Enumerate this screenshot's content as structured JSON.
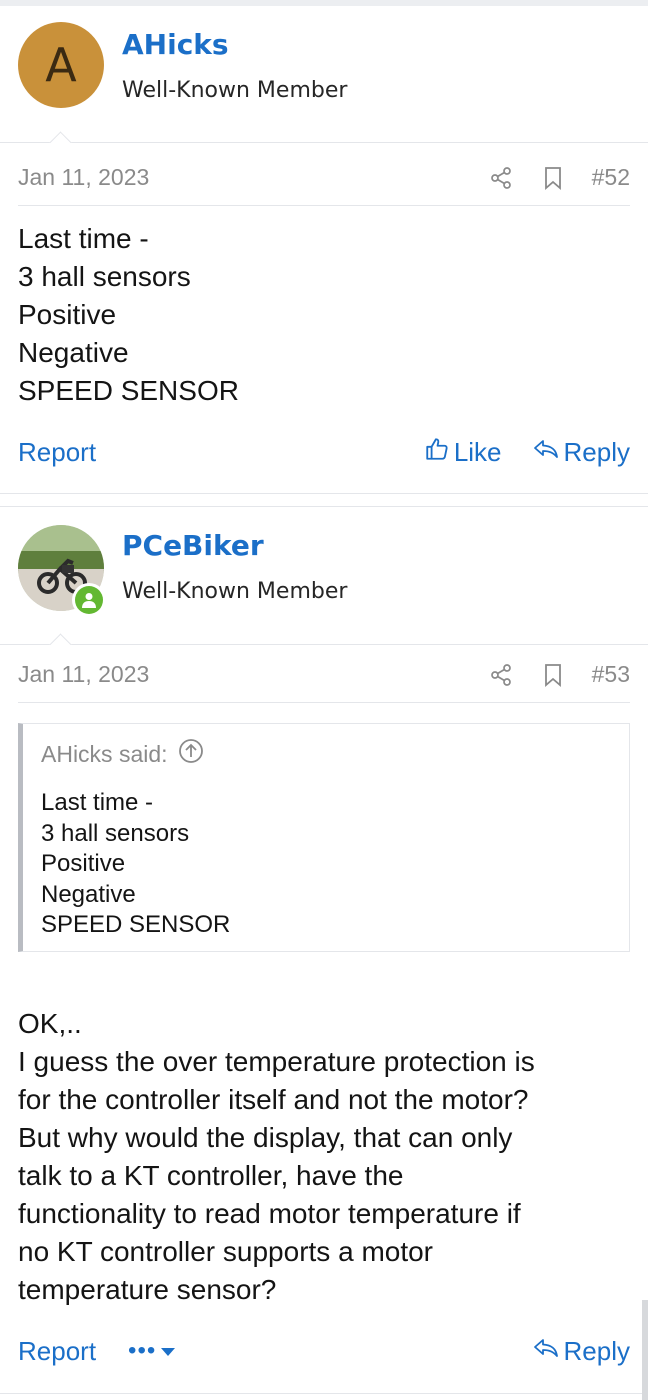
{
  "posts": [
    {
      "avatar_letter": "A",
      "username": "AHicks",
      "user_title": "Well-Known Member",
      "date": "Jan 11, 2023",
      "post_number": "#52",
      "body_lines": [
        "Last time -",
        "3 hall sensors",
        "Positive",
        "Negative",
        "SPEED SENSOR"
      ],
      "actions": {
        "report": "Report",
        "like": "Like",
        "reply": "Reply"
      }
    },
    {
      "username": "PCeBiker",
      "user_title": "Well-Known Member",
      "online": true,
      "date": "Jan 11, 2023",
      "post_number": "#53",
      "quote": {
        "header": "AHicks said:",
        "lines": [
          "Last time -",
          "3 hall sensors",
          "Positive",
          "Negative",
          "SPEED SENSOR"
        ]
      },
      "body_lines": [
        "OK,..",
        "I guess the over temperature protection is",
        "for the controller itself and not the motor?",
        "But why would the display, that can only",
        "talk to a KT controller, have the",
        "functionality to read motor temperature if",
        "no KT controller supports a motor",
        "temperature sensor?"
      ],
      "actions": {
        "report": "Report",
        "more": "•••",
        "reply": "Reply"
      }
    }
  ],
  "colors": {
    "link": "#1b6fc8",
    "muted": "#8a8a8a",
    "avatar_bg": "#c9913a",
    "online": "#63b832"
  },
  "icons": [
    "share-icon",
    "bookmark-icon",
    "thumbs-up-icon",
    "reply-icon",
    "arrow-up-circle-icon",
    "chevron-down-icon"
  ]
}
